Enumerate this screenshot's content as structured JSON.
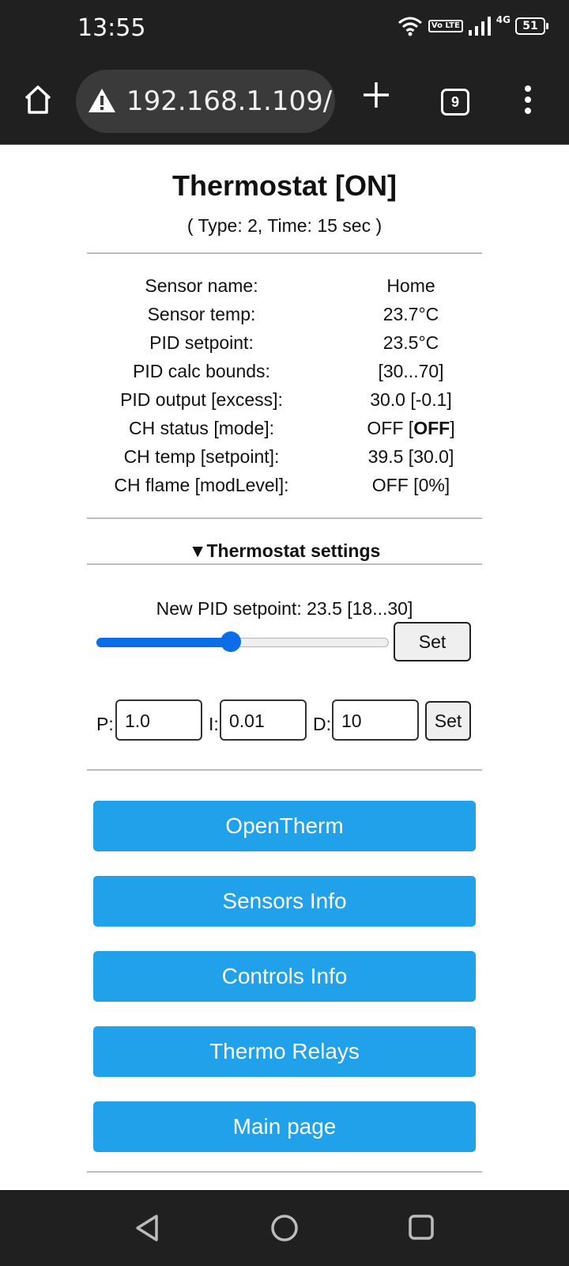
{
  "status_bar": {
    "time": "13:55",
    "network_label": "4G",
    "volte_label": "Vo LTE",
    "battery": "51",
    "icons": [
      "wifi-icon",
      "volte-icon",
      "signal-icon",
      "battery-icon"
    ]
  },
  "browser": {
    "url": "192.168.1.109/",
    "tab_count": "9",
    "icons": [
      "home-icon",
      "warning-icon",
      "plus-icon",
      "tabs-icon",
      "menu-icon"
    ]
  },
  "page": {
    "title": "Thermostat [ON]",
    "subtitle": "( Type: 2, Time: 15 sec )",
    "info_rows": [
      {
        "label": "Sensor name:",
        "value": "Home",
        "bold": ""
      },
      {
        "label": "Sensor temp:",
        "value": "23.7°C",
        "bold": ""
      },
      {
        "label": "PID setpoint:",
        "value": "23.5°C",
        "bold": ""
      },
      {
        "label": "PID calc bounds:",
        "value": "[30...70]",
        "bold": ""
      },
      {
        "label": "PID output [excess]:",
        "value": "30.0 [-0.1]",
        "bold": ""
      },
      {
        "label": "CH status [mode]:",
        "value": "OFF [",
        "bold": "OFF",
        "suffix": "]"
      },
      {
        "label": "CH temp [setpoint]:",
        "value": "39.5 [30.0]",
        "bold": ""
      },
      {
        "label": "CH flame [modLevel]:",
        "value": "OFF [0%]",
        "bold": ""
      }
    ],
    "settings": {
      "toggle_label": "▼Thermostat settings",
      "setpoint_label": "New PID setpoint: 23.5 [18...30]",
      "slider": {
        "min": 18,
        "max": 30,
        "value": 23.5
      },
      "set_label": "Set",
      "p_label": "P:",
      "p_value": "1.0",
      "i_label": "I:",
      "i_value": "0.01",
      "d_label": "D:",
      "d_value": "10",
      "pid_set_label": "Set"
    },
    "nav_buttons": [
      "OpenTherm",
      "Sensors Info",
      "Controls Info",
      "Thermo Relays",
      "Main page"
    ]
  },
  "navbar": {
    "icons": [
      "back-icon",
      "home-circle-icon",
      "recents-icon"
    ]
  },
  "colors": {
    "accent": "#21a1ea",
    "slider": "#0b6de8",
    "system_bar": "#202020"
  }
}
